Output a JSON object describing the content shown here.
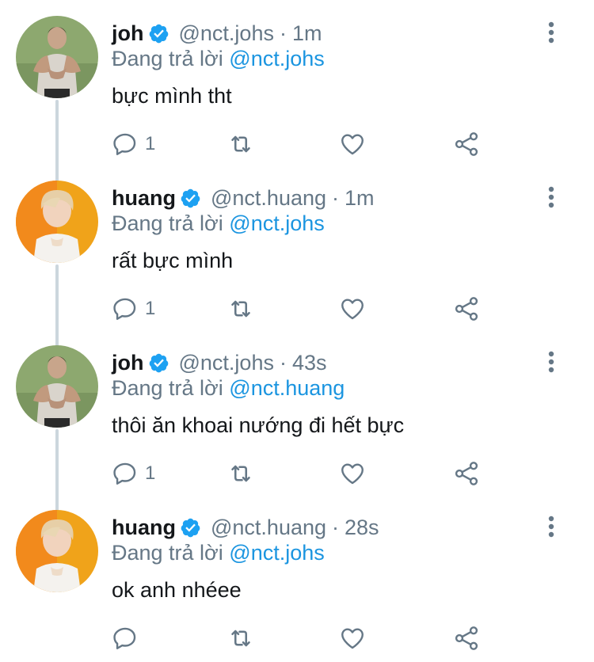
{
  "colors": {
    "link": "#1b95e0",
    "muted": "#657786",
    "text": "#14171a",
    "verified": "#1da1f2",
    "thread_line": "#ccd6dd"
  },
  "reply_prefix": "Đang trả lời",
  "tweets": [
    {
      "name": "joh",
      "verified": true,
      "handle": "@nct.johs",
      "separator": "·",
      "time": "1m",
      "reply_to": "@nct.johs",
      "text": "bực mình tht",
      "reply_count": "1",
      "avatar_icon": "avatar-photo"
    },
    {
      "name": "huang",
      "verified": true,
      "handle": "@nct.huang",
      "separator": "·",
      "time": "1m",
      "reply_to": "@nct.johs",
      "text": "rất bực mình",
      "reply_count": "1",
      "avatar_icon": "avatar-photo"
    },
    {
      "name": "joh",
      "verified": true,
      "handle": "@nct.johs",
      "separator": "·",
      "time": "43s",
      "reply_to": "@nct.huang",
      "text": "thôi ăn khoai nướng đi hết bực",
      "reply_count": "1",
      "avatar_icon": "avatar-photo"
    },
    {
      "name": "huang",
      "verified": true,
      "handle": "@nct.huang",
      "separator": "·",
      "time": "28s",
      "reply_to": "@nct.johs",
      "text": "ok anh nhéee",
      "reply_count": "",
      "avatar_icon": "avatar-photo"
    }
  ]
}
